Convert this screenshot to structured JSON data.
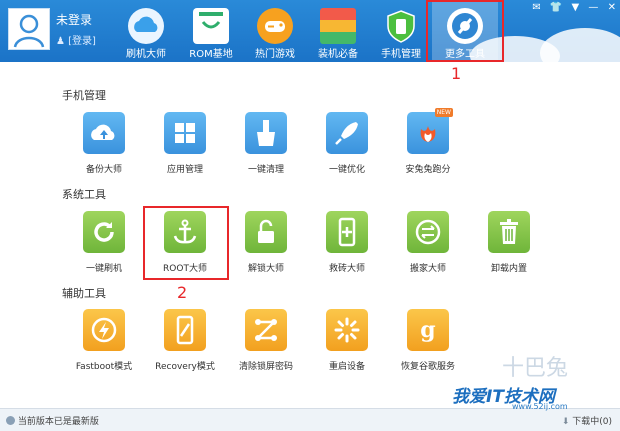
{
  "user": {
    "name": "未登录",
    "login_label": "[登录]"
  },
  "nav": [
    {
      "label": "刷机大师",
      "icon": "cloud-icon"
    },
    {
      "label": "ROM基地",
      "icon": "shopping-bag-icon"
    },
    {
      "label": "热门游戏",
      "icon": "gamepad-icon"
    },
    {
      "label": "装机必备",
      "icon": "bookshelf-icon"
    },
    {
      "label": "手机管理",
      "icon": "phone-shield-icon"
    },
    {
      "label": "更多工具",
      "icon": "gear-tools-icon"
    }
  ],
  "markers": {
    "first": "1",
    "second": "2"
  },
  "sections": {
    "phone_manage": {
      "title": "手机管理",
      "tools": [
        {
          "label": "备份大师",
          "icon": "cloud-upload-icon"
        },
        {
          "label": "应用管理",
          "icon": "grid-icon"
        },
        {
          "label": "一键清理",
          "icon": "broom-icon"
        },
        {
          "label": "一键优化",
          "icon": "rocket-icon"
        },
        {
          "label": "安兔兔跑分",
          "icon": "antutu-icon",
          "badge": "NEW"
        }
      ]
    },
    "system_tools": {
      "title": "系统工具",
      "tools": [
        {
          "label": "一键刷机",
          "icon": "refresh-icon"
        },
        {
          "label": "ROOT大师",
          "icon": "anchor-icon"
        },
        {
          "label": "解锁大师",
          "icon": "unlock-icon"
        },
        {
          "label": "救砖大师",
          "icon": "phone-plus-icon"
        },
        {
          "label": "搬家大师",
          "icon": "transfer-icon"
        },
        {
          "label": "卸载内置",
          "icon": "trash-icon"
        }
      ]
    },
    "aux_tools": {
      "title": "辅助工具",
      "tools": [
        {
          "label": "Fastboot模式",
          "icon": "lightning-icon"
        },
        {
          "label": "Recovery模式",
          "icon": "phone-slash-icon"
        },
        {
          "label": "清除锁屏密码",
          "icon": "pattern-lock-icon"
        },
        {
          "label": "重启设备",
          "icon": "loading-icon"
        },
        {
          "label": "恢复谷歌服务",
          "icon": "google-g-icon"
        }
      ]
    }
  },
  "status": {
    "left": "当前版本已是最新版",
    "right": "下载中(0)"
  },
  "watermark": {
    "line1": "十巴兔",
    "line2": "我爱IT技术网",
    "line3": "www.52ij.com"
  },
  "colors": {
    "topbar": "#1b73c7",
    "blue_tile": "#3a92dd",
    "green_tile": "#6fb53a",
    "orange_tile": "#f2a01f",
    "marker": "#e8272a"
  }
}
